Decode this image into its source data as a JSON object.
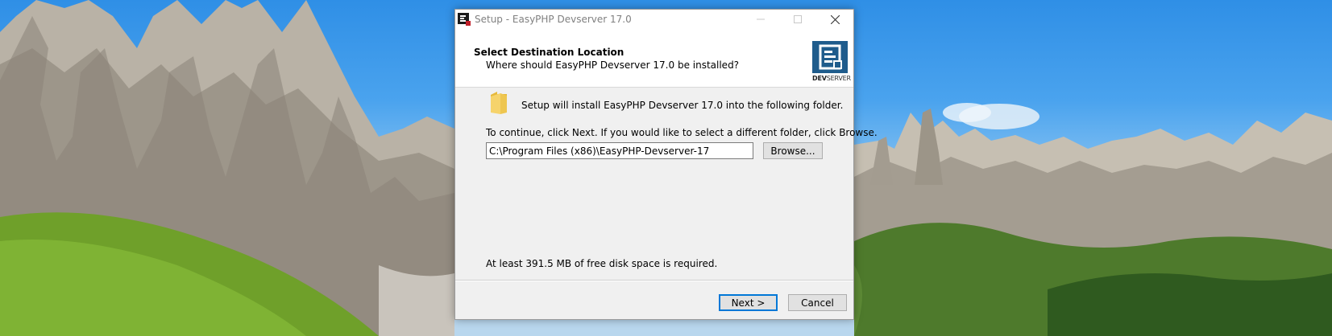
{
  "window": {
    "title": "Setup - EasyPHP Devserver 17.0",
    "controls": {
      "minimize_icon": "minimize-icon",
      "maximize_icon": "maximize-icon",
      "close_icon": "close-icon"
    }
  },
  "header": {
    "title": "Select Destination Location",
    "subtitle": "Where should EasyPHP Devserver 17.0 be installed?",
    "logo_text_dev": "DEV",
    "logo_text_server": "SERVER"
  },
  "content": {
    "install_message": "Setup will install EasyPHP Devserver 17.0 into the following folder.",
    "instruction": "To continue, click Next. If you would like to select a different folder, click Browse.",
    "path_value": "C:\\Program Files (x86)\\EasyPHP-Devserver-17",
    "browse_label": "Browse...",
    "disk_space": "At least 391.5 MB of free disk space is required."
  },
  "footer": {
    "next_label": "Next >",
    "cancel_label": "Cancel"
  },
  "colors": {
    "accent": "#0078d7",
    "logo_blue": "#1f5c8c",
    "folder_yellow": "#f2c94c"
  }
}
